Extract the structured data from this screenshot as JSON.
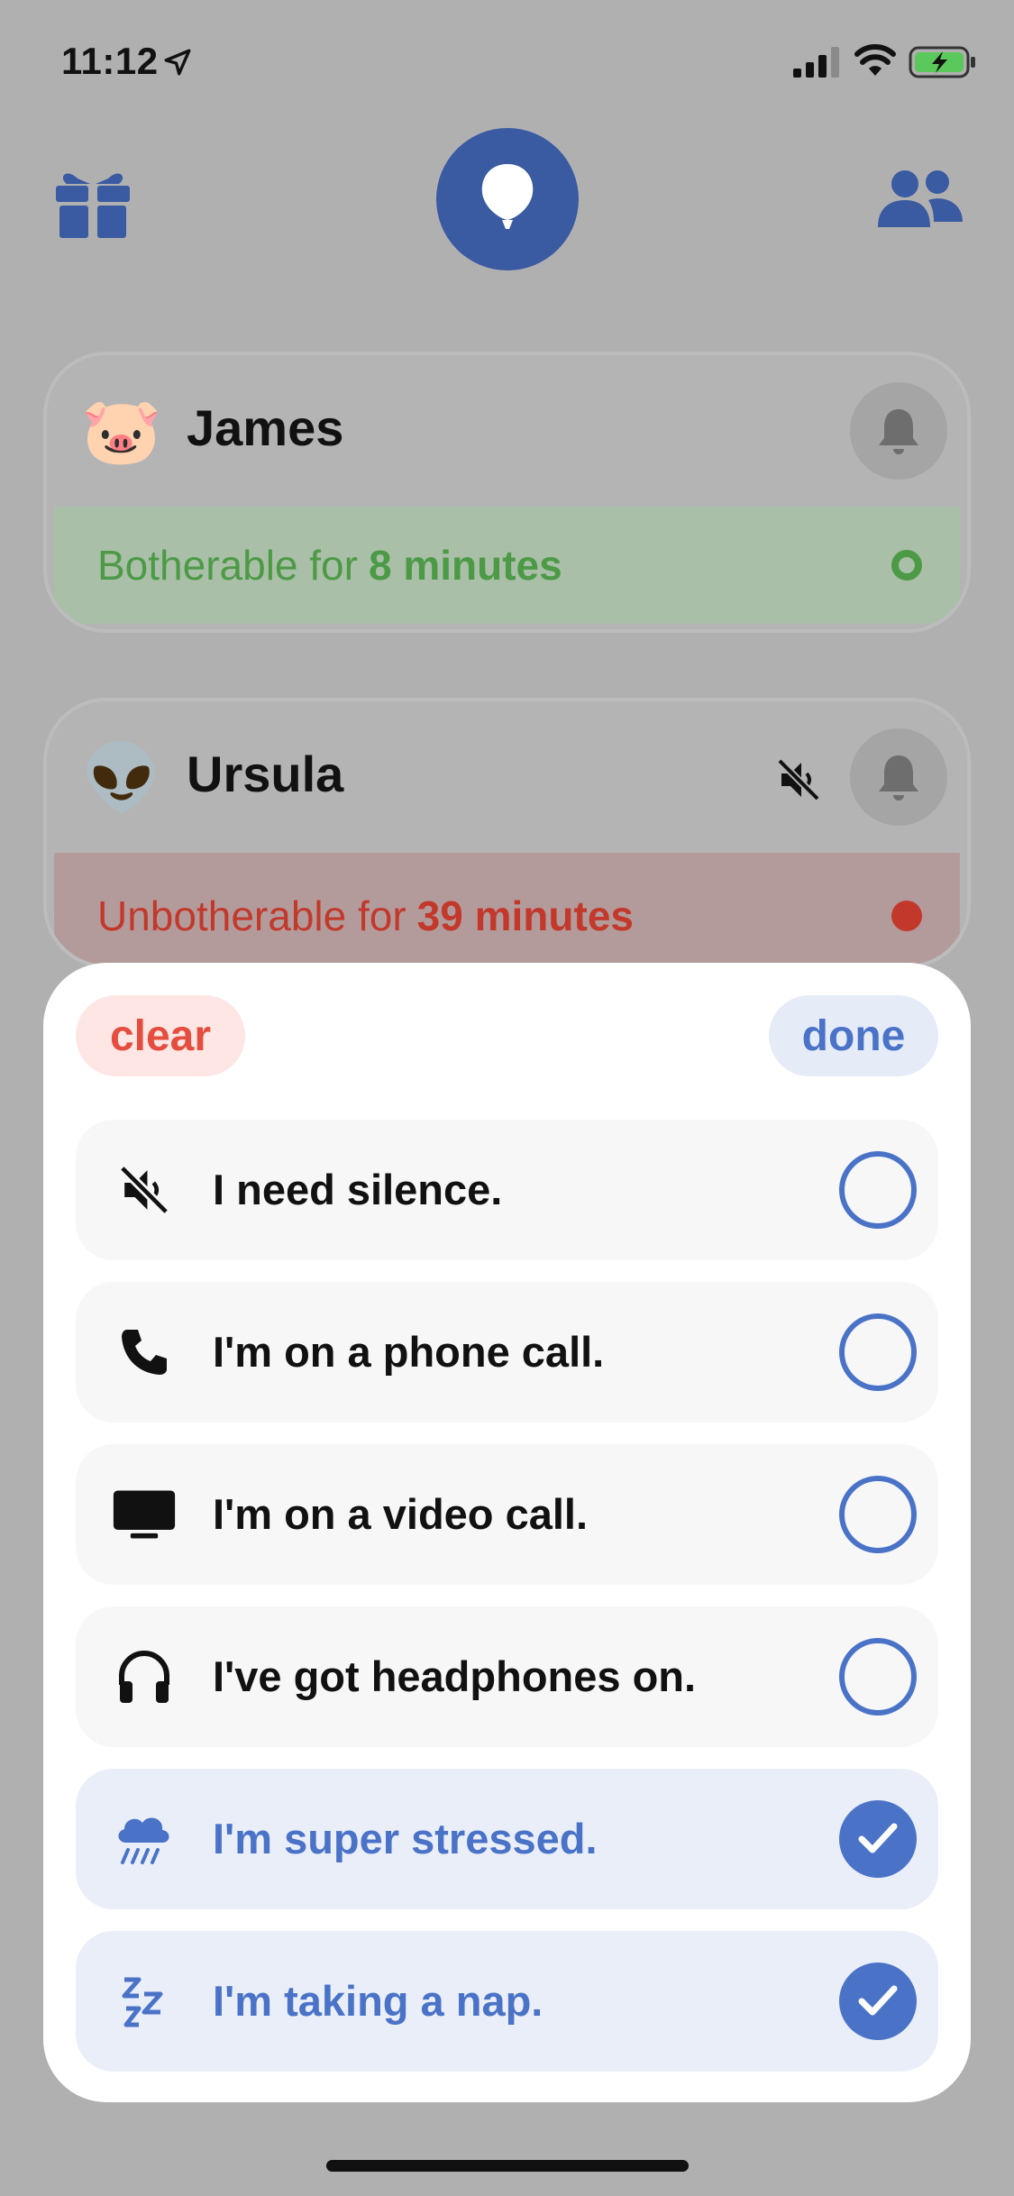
{
  "status_bar": {
    "time": "11:12",
    "location_icon": "location-arrow-icon",
    "signal_icon": "cellular-signal-icon",
    "wifi_icon": "wifi-icon",
    "battery_icon": "battery-charging-icon"
  },
  "header": {
    "left_icon": "gift-icon",
    "center_icon": "balloon-icon",
    "right_icon": "people-icon",
    "accent": "#3a5aa2"
  },
  "people": [
    {
      "emoji": "🐷",
      "name": "James",
      "status_prefix": "Botherable for",
      "status_value": "8 minutes",
      "status_color": "#4d9a46",
      "muted": false
    },
    {
      "emoji": "👽",
      "name": "Ursula",
      "status_prefix": "Unbotherable for",
      "status_value": "39 minutes",
      "status_color": "#c2392c",
      "muted": true
    }
  ],
  "sheet": {
    "clear_label": "clear",
    "done_label": "done",
    "options": [
      {
        "icon": "speaker-muted-icon",
        "label": "I need silence.",
        "selected": false
      },
      {
        "icon": "phone-icon",
        "label": "I'm on a phone call.",
        "selected": false
      },
      {
        "icon": "tv-icon",
        "label": "I'm on a video call.",
        "selected": false
      },
      {
        "icon": "headphones-icon",
        "label": "I've got headphones on.",
        "selected": false
      },
      {
        "icon": "cloud-rain-icon",
        "label": "I'm super stressed.",
        "selected": true
      },
      {
        "icon": "zzz-icon",
        "label": "I'm taking a nap.",
        "selected": true
      }
    ],
    "accent": "#4a73c8",
    "clear_color": "#e54d3f"
  }
}
